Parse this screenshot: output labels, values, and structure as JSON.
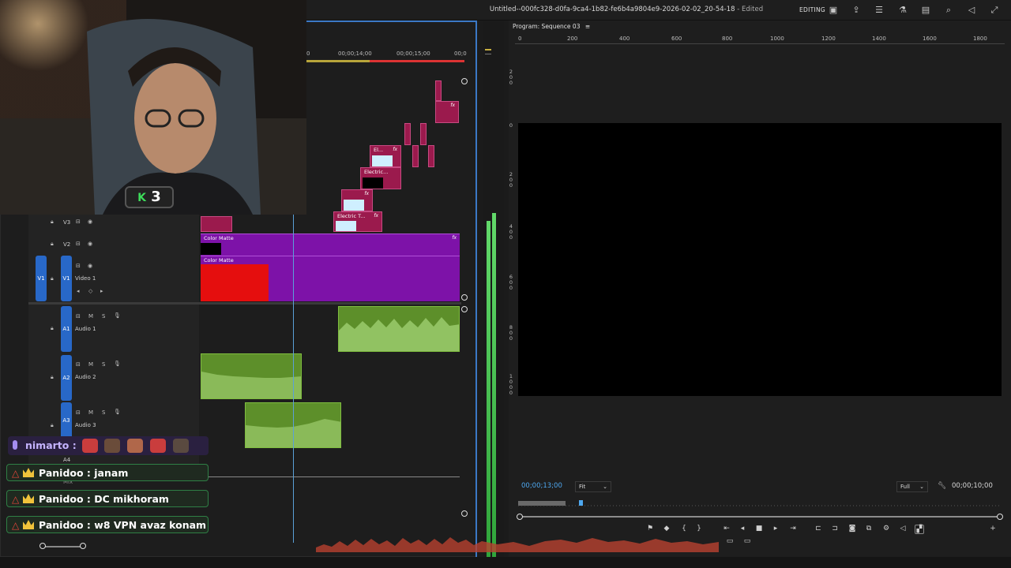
{
  "window": {
    "title": "Untitled--000fc328-d0fa-9ca4-1b82-fe6b4a9804e9-2026-02-02_20-54-18",
    "edited": "- Edited",
    "workspace": "EDITING"
  },
  "topbar_icons": [
    "panel-icon",
    "share-icon",
    "menu-icon",
    "flask-icon",
    "comment-icon",
    "search-icon",
    "volume-icon",
    "fullscreen-icon"
  ],
  "timeline": {
    "ruler_labels": [
      "0",
      "00;00;14;00",
      "00;00;15;00",
      "00;0"
    ],
    "tracks": {
      "v3": {
        "label": "V3"
      },
      "v2": {
        "label": "V2"
      },
      "v1": {
        "badge": "V1",
        "label": "V1",
        "name": "Video 1"
      },
      "a1": {
        "label": "A1",
        "name": "Audio 1"
      },
      "a2": {
        "label": "A2",
        "name": "Audio 2"
      },
      "a3": {
        "label": "A3",
        "name": "Audio 3"
      },
      "a4": {
        "label": "A4"
      }
    },
    "track_controls": {
      "mute": "M",
      "solo": "S"
    },
    "clips": {
      "color_matte_v2": "Color Matte",
      "color_matte_v1": "Color Matte",
      "electric_1": "Electric T...",
      "electric_2": "Electric...",
      "el_3": "El...",
      "fx": "fx"
    },
    "mix_label": "Mix"
  },
  "program_monitor": {
    "title": "Program: Sequence 03",
    "ruler_labels": [
      "0",
      "200",
      "400",
      "600",
      "800",
      "1000",
      "1200",
      "1400",
      "1600",
      "1800"
    ],
    "vruler_labels": [
      "2 0 0",
      "0",
      "2 0 0",
      "4 0 0",
      "6 0 0",
      "8 0 0",
      "1 0 0 0"
    ],
    "timecode_current": "00;00;13;00",
    "fit": "Fit",
    "resolution": "Full",
    "timecode_duration": "00;00;10;00",
    "colors": {
      "timecode": "#4ea8f0",
      "accent": "#2868c8"
    }
  },
  "webcam": {
    "badge_letter": "K",
    "badge_number": "3"
  },
  "chat": {
    "voice_user": "nimarto :",
    "messages": [
      {
        "user": "Panidoo",
        "text": "Panidoo : janam"
      },
      {
        "user": "Panidoo",
        "text": "Panidoo : DC mikhoram"
      },
      {
        "user": "Panidoo",
        "text": "Panidoo : w8 VPN avaz konam"
      }
    ]
  }
}
